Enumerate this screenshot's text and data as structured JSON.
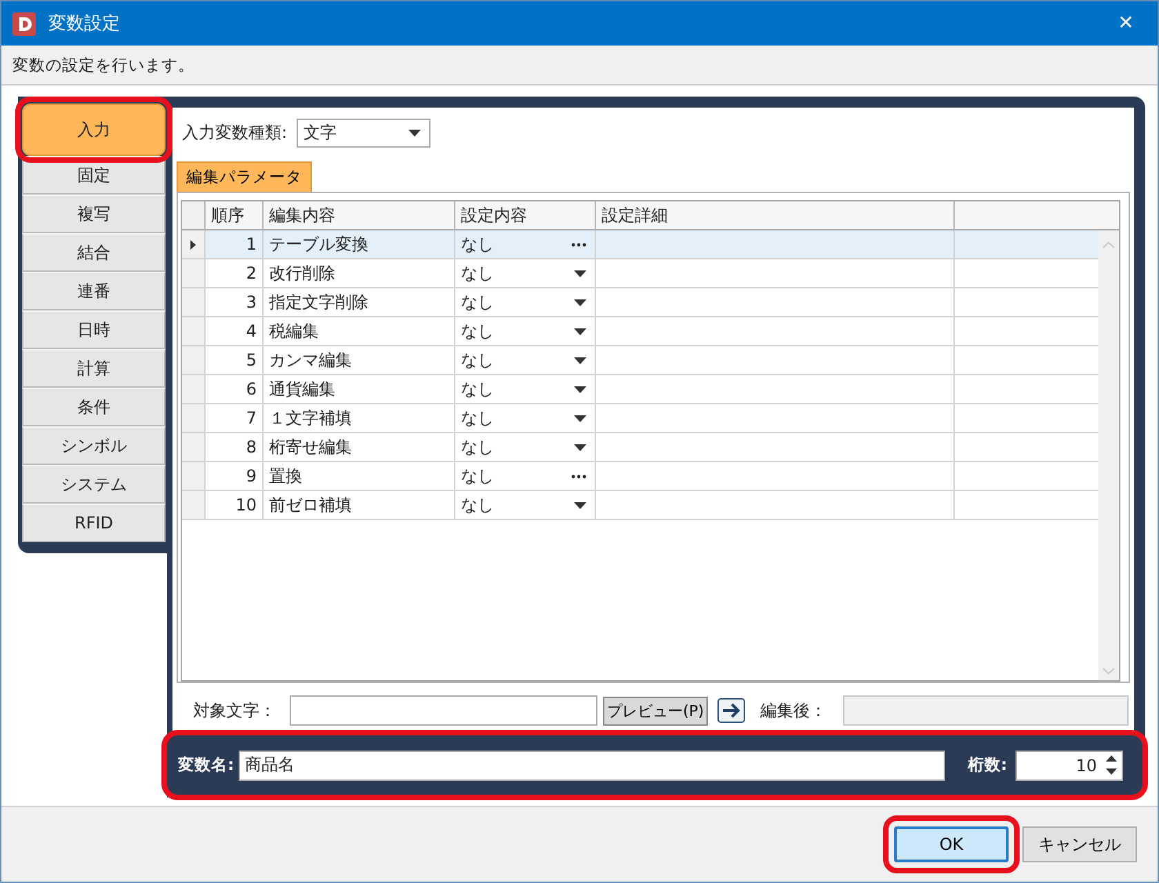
{
  "window": {
    "title": "変数設定",
    "close": "✕"
  },
  "description": "変数の設定を行います。",
  "nav": [
    {
      "label": "入力",
      "selected": true,
      "highlighted": true
    },
    {
      "label": "固定",
      "selected": false,
      "highlighted": false
    },
    {
      "label": "複写",
      "selected": false,
      "highlighted": false
    },
    {
      "label": "結合",
      "selected": false,
      "highlighted": false
    },
    {
      "label": "連番",
      "selected": false,
      "highlighted": false
    },
    {
      "label": "日時",
      "selected": false,
      "highlighted": false
    },
    {
      "label": "計算",
      "selected": false,
      "highlighted": false
    },
    {
      "label": "条件",
      "selected": false,
      "highlighted": false
    },
    {
      "label": "シンボル",
      "selected": false,
      "highlighted": false
    },
    {
      "label": "システム",
      "selected": false,
      "highlighted": false
    },
    {
      "label": "RFID",
      "selected": false,
      "highlighted": false
    }
  ],
  "input_type": {
    "label": "入力変数種類:",
    "value": "文字"
  },
  "tabs": [
    {
      "label": "編集パラメータ",
      "selected": true
    }
  ],
  "table": {
    "columns": [
      "順序",
      "編集内容",
      "設定内容",
      "設定詳細"
    ],
    "rows": [
      {
        "order": "1",
        "content": "テーブル変換",
        "setting": "なし",
        "kind": "ellipsis",
        "selected": true
      },
      {
        "order": "2",
        "content": "改行削除",
        "setting": "なし",
        "kind": "dropdown",
        "selected": false
      },
      {
        "order": "3",
        "content": "指定文字削除",
        "setting": "なし",
        "kind": "dropdown",
        "selected": false
      },
      {
        "order": "4",
        "content": "税編集",
        "setting": "なし",
        "kind": "dropdown",
        "selected": false
      },
      {
        "order": "5",
        "content": "カンマ編集",
        "setting": "なし",
        "kind": "dropdown",
        "selected": false
      },
      {
        "order": "6",
        "content": "通貨編集",
        "setting": "なし",
        "kind": "dropdown",
        "selected": false
      },
      {
        "order": "7",
        "content": "１文字補填",
        "setting": "なし",
        "kind": "dropdown",
        "selected": false
      },
      {
        "order": "8",
        "content": "桁寄せ編集",
        "setting": "なし",
        "kind": "dropdown",
        "selected": false
      },
      {
        "order": "9",
        "content": "置換",
        "setting": "なし",
        "kind": "ellipsis",
        "selected": false
      },
      {
        "order": "10",
        "content": "前ゼロ補填",
        "setting": "なし",
        "kind": "dropdown",
        "selected": false
      }
    ]
  },
  "preview": {
    "target_label": "対象文字：",
    "button": "プレビュー(P)",
    "result_label": "編集後："
  },
  "name_bar": {
    "name_label": "変数名:",
    "name_value": "商品名",
    "digits_label": "桁数:",
    "digits_value": "10",
    "highlighted": true
  },
  "buttons": [
    {
      "label": "OK",
      "default": true,
      "highlighted": true
    },
    {
      "label": "キャンセル",
      "default": false,
      "highlighted": false
    }
  ]
}
